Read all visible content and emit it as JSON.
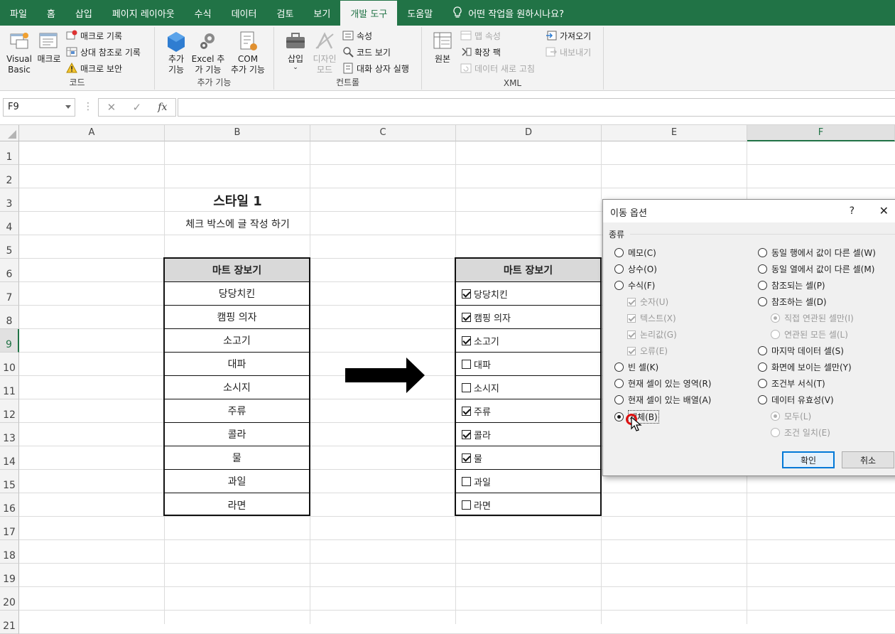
{
  "menu": {
    "tabs": [
      "파일",
      "홈",
      "삽입",
      "페이지 레이아웃",
      "수식",
      "데이터",
      "검토",
      "보기",
      "개발 도구",
      "도움말"
    ],
    "active_tab": "개발 도구",
    "tell_me": "어떤 작업을 원하시나요?"
  },
  "ribbon": {
    "code": {
      "label": "코드",
      "visual_basic": "Visual\nBasic",
      "macro": "매크로",
      "record_macro": "매크로 기록",
      "relative_ref": "상대 참조로 기록",
      "macro_security": "매크로 보안"
    },
    "addins": {
      "label": "추가 기능",
      "addins": "추가\n기능",
      "excel_addins": "Excel 추\n가 기능",
      "com_addins": "COM\n추가 기능"
    },
    "controls": {
      "label": "컨트롤",
      "insert": "삽입",
      "design_mode": "디자인\n모드",
      "properties": "속성",
      "view_code": "코드 보기",
      "run_dialog": "대화 상자 실행"
    },
    "xml": {
      "label": "XML",
      "source": "원본",
      "map_properties": "맵 속성",
      "expansion_packs": "확장 팩",
      "refresh_data": "데이터 새로 고침",
      "import": "가져오기",
      "export": "내보내기"
    }
  },
  "formula_bar": {
    "name_box": "F9",
    "fx": "fx",
    "cancel": "✕",
    "enter": "✓",
    "formula": ""
  },
  "grid": {
    "columns": [
      "A",
      "B",
      "C",
      "D",
      "E",
      "F"
    ],
    "selected_column": "F",
    "rows": [
      "1",
      "2",
      "3",
      "4",
      "5",
      "6",
      "7",
      "8",
      "9",
      "10",
      "11",
      "12",
      "13",
      "14",
      "15",
      "16",
      "17",
      "18",
      "19",
      "20",
      "21"
    ],
    "selected_row": "9"
  },
  "sheet": {
    "title": "스타일 1",
    "subtitle": "체크 박스에 글 작성 하기",
    "table_header": "마트 장보기",
    "items": [
      "당당치킨",
      "캠핑 의자",
      "소고기",
      "대파",
      "소시지",
      "주류",
      "콜라",
      "물",
      "과일",
      "라면"
    ],
    "checked": [
      true,
      true,
      true,
      false,
      false,
      true,
      true,
      true,
      false,
      false
    ]
  },
  "dialog": {
    "title": "이동 옵션",
    "help": "?",
    "close": "✕",
    "section": "종류",
    "left_options": [
      {
        "label": "메모(C)",
        "selected": false,
        "enabled": true
      },
      {
        "label": "상수(O)",
        "selected": false,
        "enabled": true
      },
      {
        "label": "수식(F)",
        "selected": false,
        "enabled": true
      }
    ],
    "formula_sub": [
      "숫자(U)",
      "텍스트(X)",
      "논리값(G)",
      "오류(E)"
    ],
    "left_options2": [
      {
        "label": "빈 셀(K)",
        "selected": false
      },
      {
        "label": "현재 셀이 있는 영역(R)",
        "selected": false
      },
      {
        "label": "현재 셀이 있는 배열(A)",
        "selected": false
      },
      {
        "label": "개체(B)",
        "selected": true
      }
    ],
    "right_options": [
      {
        "label": "동일 행에서 값이 다른 셀(W)",
        "enabled": true
      },
      {
        "label": "동일 열에서 값이 다른 셀(M)",
        "enabled": true
      },
      {
        "label": "참조되는 셀(P)",
        "enabled": true
      },
      {
        "label": "참조하는 셀(D)",
        "enabled": true
      }
    ],
    "ref_sub": [
      "직접 연관된 셀만(I)",
      "연관된 모든 셀(L)"
    ],
    "right_options2": [
      {
        "label": "마지막 데이터 셀(S)"
      },
      {
        "label": "화면에 보이는 셀만(Y)"
      },
      {
        "label": "조건부 서식(T)"
      },
      {
        "label": "데이터 유효성(V)"
      }
    ],
    "validation_sub": [
      "모두(L)",
      "조건 일치(E)"
    ],
    "ok": "확인",
    "cancel": "취소"
  }
}
